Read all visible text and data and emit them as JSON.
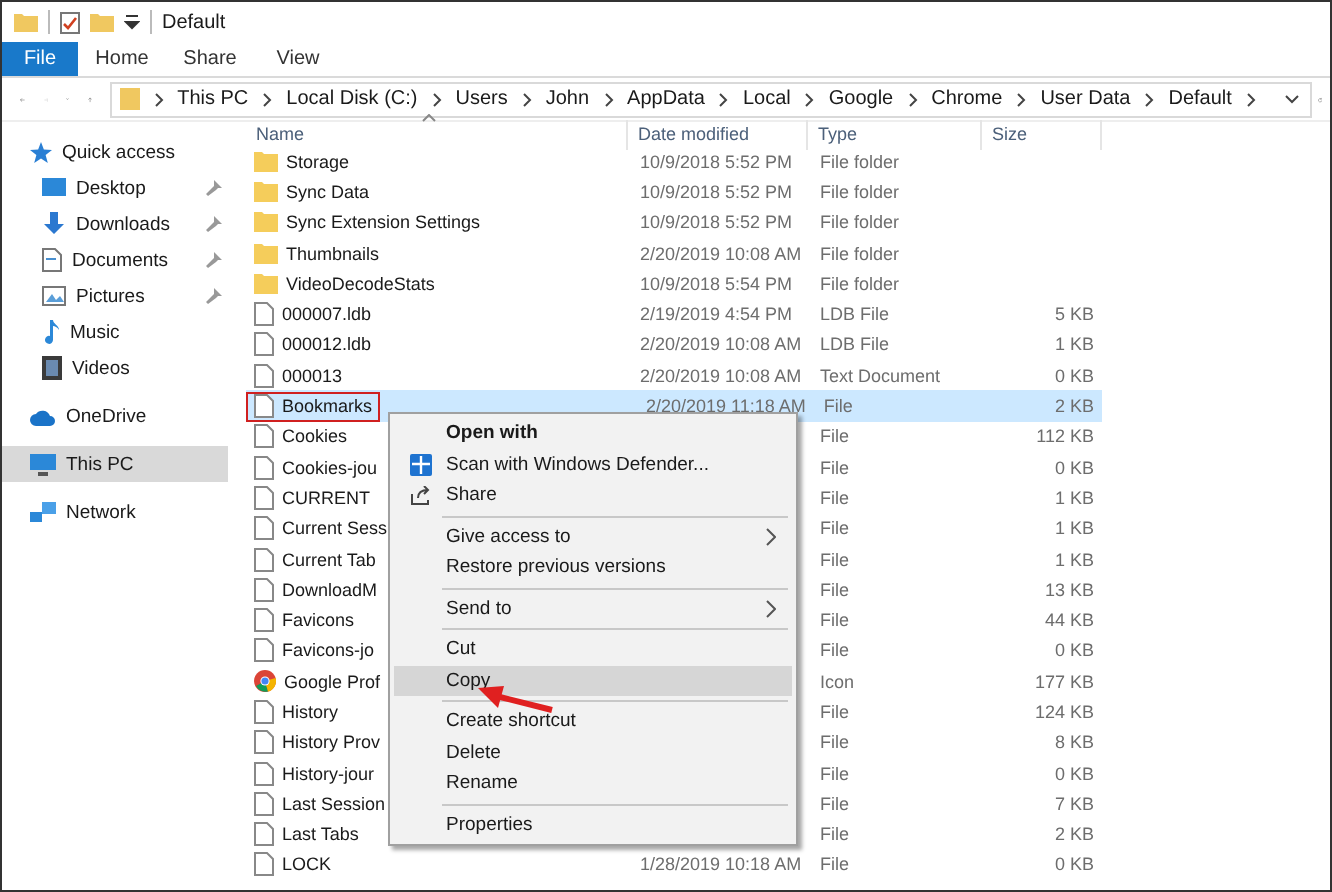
{
  "window": {
    "title": "Default"
  },
  "ribbon_tabs": [
    {
      "label": "File",
      "selected": true
    },
    {
      "label": "Home",
      "selected": false
    },
    {
      "label": "Share",
      "selected": false
    },
    {
      "label": "View",
      "selected": false
    }
  ],
  "address_bar": {
    "path": [
      "This PC",
      "Local Disk (C:)",
      "Users",
      "John",
      "AppData",
      "Local",
      "Google",
      "Chrome",
      "User Data",
      "Default"
    ]
  },
  "sidebar": {
    "items": [
      {
        "label": "Quick access",
        "selected": false,
        "children": [
          {
            "label": "Desktop",
            "pinned": true
          },
          {
            "label": "Downloads",
            "pinned": true
          },
          {
            "label": "Documents",
            "pinned": true
          },
          {
            "label": "Pictures",
            "pinned": true
          },
          {
            "label": "Music",
            "pinned": false
          },
          {
            "label": "Videos",
            "pinned": false
          }
        ]
      },
      {
        "label": "OneDrive",
        "selected": false
      },
      {
        "label": "This PC",
        "selected": true
      },
      {
        "label": "Network",
        "selected": false
      }
    ]
  },
  "table": {
    "columns": [
      "Name",
      "Date modified",
      "Type",
      "Size"
    ],
    "rows": [
      {
        "kind": "folder",
        "name": "Storage",
        "date": "10/9/2018 5:52 PM",
        "type": "File folder",
        "selected": false,
        "outlined": false
      },
      {
        "kind": "folder",
        "name": "Sync Data",
        "date": "10/9/2018 5:52 PM",
        "type": "File folder",
        "selected": false,
        "outlined": false
      },
      {
        "kind": "folder",
        "name": "Sync Extension Settings",
        "date": "10/9/2018 5:52 PM",
        "type": "File folder",
        "selected": false,
        "outlined": false
      },
      {
        "kind": "folder",
        "name": "Thumbnails",
        "date": "2/20/2019 10:08 AM",
        "type": "File folder",
        "selected": false,
        "outlined": false
      },
      {
        "kind": "folder",
        "name": "VideoDecodeStats",
        "date": "10/9/2018 5:54 PM",
        "type": "File folder",
        "selected": false,
        "outlined": false
      },
      {
        "kind": "file",
        "name": "000007.ldb",
        "date": "2/19/2019 4:54 PM",
        "type": "LDB File",
        "size": "5 KB",
        "selected": false,
        "outlined": false
      },
      {
        "kind": "file",
        "name": "000012.ldb",
        "date": "2/20/2019 10:08 AM",
        "type": "LDB File",
        "size": "1 KB",
        "selected": false,
        "outlined": false
      },
      {
        "kind": "file",
        "name": "000013",
        "date": "2/20/2019 10:08 AM",
        "type": "Text Document",
        "size": "0 KB",
        "selected": false,
        "outlined": false
      },
      {
        "kind": "file",
        "name": "Bookmarks",
        "date": "2/20/2019 11:18 AM",
        "type": "File",
        "size": "2 KB",
        "selected": true,
        "outlined": true
      },
      {
        "kind": "file",
        "name": "Cookies",
        "type": "File",
        "size": "112 KB",
        "selected": false,
        "outlined": false
      },
      {
        "kind": "file",
        "name": "Cookies-jou",
        "type": "File",
        "size": "0 KB",
        "selected": false,
        "outlined": false
      },
      {
        "kind": "file",
        "name": "CURRENT",
        "type": "File",
        "size": "1 KB",
        "selected": false,
        "outlined": false
      },
      {
        "kind": "file",
        "name": "Current Sess",
        "type": "File",
        "size": "1 KB",
        "selected": false,
        "outlined": false
      },
      {
        "kind": "file",
        "name": "Current Tab",
        "type": "File",
        "size": "1 KB",
        "selected": false,
        "outlined": false
      },
      {
        "kind": "file",
        "name": "DownloadM",
        "type": "File",
        "size": "13 KB",
        "selected": false,
        "outlined": false
      },
      {
        "kind": "file",
        "name": "Favicons",
        "type": "File",
        "size": "44 KB",
        "selected": false,
        "outlined": false
      },
      {
        "kind": "file",
        "name": "Favicons-jo",
        "type": "File",
        "size": "0 KB",
        "selected": false,
        "outlined": false
      },
      {
        "kind": "chrome",
        "name": "Google Prof",
        "type": "Icon",
        "size": "177 KB",
        "selected": false,
        "outlined": false
      },
      {
        "kind": "file",
        "name": "History",
        "type": "File",
        "size": "124 KB",
        "selected": false,
        "outlined": false
      },
      {
        "kind": "file",
        "name": "History Prov",
        "type": "File",
        "size": "8 KB",
        "selected": false,
        "outlined": false
      },
      {
        "kind": "file",
        "name": "History-jour",
        "type": "File",
        "size": "0 KB",
        "selected": false,
        "outlined": false
      },
      {
        "kind": "file",
        "name": "Last Session",
        "type": "File",
        "size": "7 KB",
        "selected": false,
        "outlined": false
      },
      {
        "kind": "file",
        "name": "Last Tabs",
        "type": "File",
        "size": "2 KB",
        "selected": false,
        "outlined": false
      },
      {
        "kind": "file",
        "name": "LOCK",
        "date": "1/28/2019 10:18 AM",
        "type": "File",
        "size": "0 KB",
        "selected": false,
        "outlined": false
      }
    ]
  },
  "context_menu": {
    "items": [
      {
        "kind": "default",
        "label": "Open with",
        "submenu": false,
        "highlighted": false
      },
      {
        "kind": "item",
        "label": "Scan with Windows Defender...",
        "submenu": false,
        "highlighted": false
      },
      {
        "kind": "item",
        "label": "Share",
        "submenu": false,
        "highlighted": false
      },
      {
        "kind": "separator"
      },
      {
        "kind": "item",
        "label": "Give access to",
        "submenu": true,
        "highlighted": false
      },
      {
        "kind": "item",
        "label": "Restore previous versions",
        "submenu": false,
        "highlighted": false
      },
      {
        "kind": "separator"
      },
      {
        "kind": "item",
        "label": "Send to",
        "submenu": true,
        "highlighted": false
      },
      {
        "kind": "separator"
      },
      {
        "kind": "item",
        "label": "Cut",
        "submenu": false,
        "highlighted": false
      },
      {
        "kind": "item",
        "label": "Copy",
        "submenu": false,
        "highlighted": true
      },
      {
        "kind": "separator"
      },
      {
        "kind": "item",
        "label": "Create shortcut",
        "submenu": false,
        "highlighted": false
      },
      {
        "kind": "item",
        "label": "Delete",
        "submenu": false,
        "highlighted": false
      },
      {
        "kind": "item",
        "label": "Rename",
        "submenu": false,
        "highlighted": false
      },
      {
        "kind": "separator"
      },
      {
        "kind": "item",
        "label": "Properties",
        "submenu": false,
        "highlighted": false
      }
    ]
  }
}
